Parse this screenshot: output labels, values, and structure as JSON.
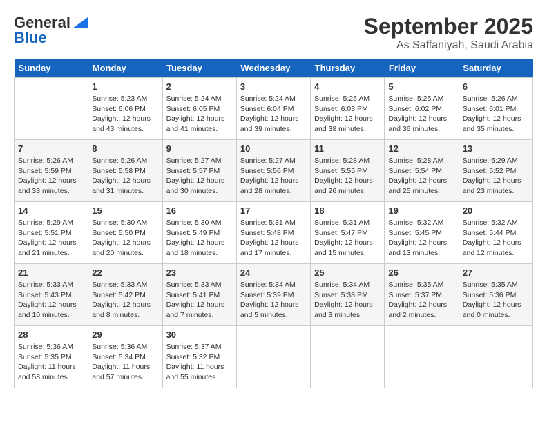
{
  "logo": {
    "line1": "General",
    "line2": "Blue"
  },
  "title": "September 2025",
  "location": "As Saffaniyah, Saudi Arabia",
  "weekdays": [
    "Sunday",
    "Monday",
    "Tuesday",
    "Wednesday",
    "Thursday",
    "Friday",
    "Saturday"
  ],
  "weeks": [
    [
      {
        "day": "",
        "sunrise": "",
        "sunset": "",
        "daylight": ""
      },
      {
        "day": "1",
        "sunrise": "5:23 AM",
        "sunset": "6:06 PM",
        "daylight": "12 hours and 43 minutes."
      },
      {
        "day": "2",
        "sunrise": "5:24 AM",
        "sunset": "6:05 PM",
        "daylight": "12 hours and 41 minutes."
      },
      {
        "day": "3",
        "sunrise": "5:24 AM",
        "sunset": "6:04 PM",
        "daylight": "12 hours and 39 minutes."
      },
      {
        "day": "4",
        "sunrise": "5:25 AM",
        "sunset": "6:03 PM",
        "daylight": "12 hours and 38 minutes."
      },
      {
        "day": "5",
        "sunrise": "5:25 AM",
        "sunset": "6:02 PM",
        "daylight": "12 hours and 36 minutes."
      },
      {
        "day": "6",
        "sunrise": "5:26 AM",
        "sunset": "6:01 PM",
        "daylight": "12 hours and 35 minutes."
      }
    ],
    [
      {
        "day": "7",
        "sunrise": "5:26 AM",
        "sunset": "5:59 PM",
        "daylight": "12 hours and 33 minutes."
      },
      {
        "day": "8",
        "sunrise": "5:26 AM",
        "sunset": "5:58 PM",
        "daylight": "12 hours and 31 minutes."
      },
      {
        "day": "9",
        "sunrise": "5:27 AM",
        "sunset": "5:57 PM",
        "daylight": "12 hours and 30 minutes."
      },
      {
        "day": "10",
        "sunrise": "5:27 AM",
        "sunset": "5:56 PM",
        "daylight": "12 hours and 28 minutes."
      },
      {
        "day": "11",
        "sunrise": "5:28 AM",
        "sunset": "5:55 PM",
        "daylight": "12 hours and 26 minutes."
      },
      {
        "day": "12",
        "sunrise": "5:28 AM",
        "sunset": "5:54 PM",
        "daylight": "12 hours and 25 minutes."
      },
      {
        "day": "13",
        "sunrise": "5:29 AM",
        "sunset": "5:52 PM",
        "daylight": "12 hours and 23 minutes."
      }
    ],
    [
      {
        "day": "14",
        "sunrise": "5:29 AM",
        "sunset": "5:51 PM",
        "daylight": "12 hours and 21 minutes."
      },
      {
        "day": "15",
        "sunrise": "5:30 AM",
        "sunset": "5:50 PM",
        "daylight": "12 hours and 20 minutes."
      },
      {
        "day": "16",
        "sunrise": "5:30 AM",
        "sunset": "5:49 PM",
        "daylight": "12 hours and 18 minutes."
      },
      {
        "day": "17",
        "sunrise": "5:31 AM",
        "sunset": "5:48 PM",
        "daylight": "12 hours and 17 minutes."
      },
      {
        "day": "18",
        "sunrise": "5:31 AM",
        "sunset": "5:47 PM",
        "daylight": "12 hours and 15 minutes."
      },
      {
        "day": "19",
        "sunrise": "5:32 AM",
        "sunset": "5:45 PM",
        "daylight": "12 hours and 13 minutes."
      },
      {
        "day": "20",
        "sunrise": "5:32 AM",
        "sunset": "5:44 PM",
        "daylight": "12 hours and 12 minutes."
      }
    ],
    [
      {
        "day": "21",
        "sunrise": "5:33 AM",
        "sunset": "5:43 PM",
        "daylight": "12 hours and 10 minutes."
      },
      {
        "day": "22",
        "sunrise": "5:33 AM",
        "sunset": "5:42 PM",
        "daylight": "12 hours and 8 minutes."
      },
      {
        "day": "23",
        "sunrise": "5:33 AM",
        "sunset": "5:41 PM",
        "daylight": "12 hours and 7 minutes."
      },
      {
        "day": "24",
        "sunrise": "5:34 AM",
        "sunset": "5:39 PM",
        "daylight": "12 hours and 5 minutes."
      },
      {
        "day": "25",
        "sunrise": "5:34 AM",
        "sunset": "5:38 PM",
        "daylight": "12 hours and 3 minutes."
      },
      {
        "day": "26",
        "sunrise": "5:35 AM",
        "sunset": "5:37 PM",
        "daylight": "12 hours and 2 minutes."
      },
      {
        "day": "27",
        "sunrise": "5:35 AM",
        "sunset": "5:36 PM",
        "daylight": "12 hours and 0 minutes."
      }
    ],
    [
      {
        "day": "28",
        "sunrise": "5:36 AM",
        "sunset": "5:35 PM",
        "daylight": "11 hours and 58 minutes."
      },
      {
        "day": "29",
        "sunrise": "5:36 AM",
        "sunset": "5:34 PM",
        "daylight": "11 hours and 57 minutes."
      },
      {
        "day": "30",
        "sunrise": "5:37 AM",
        "sunset": "5:32 PM",
        "daylight": "11 hours and 55 minutes."
      },
      {
        "day": "",
        "sunrise": "",
        "sunset": "",
        "daylight": ""
      },
      {
        "day": "",
        "sunrise": "",
        "sunset": "",
        "daylight": ""
      },
      {
        "day": "",
        "sunrise": "",
        "sunset": "",
        "daylight": ""
      },
      {
        "day": "",
        "sunrise": "",
        "sunset": "",
        "daylight": ""
      }
    ]
  ],
  "labels": {
    "sunrise": "Sunrise: ",
    "sunset": "Sunset: ",
    "daylight": "Daylight: "
  }
}
